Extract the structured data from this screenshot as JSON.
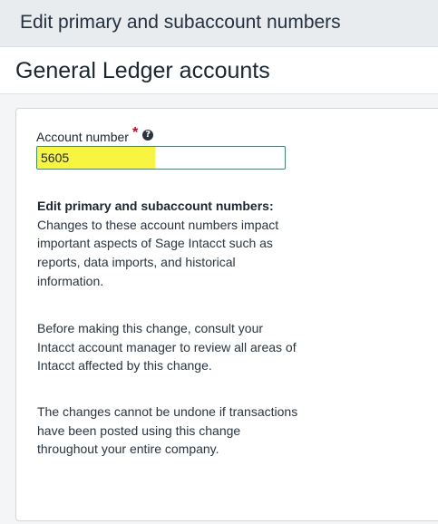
{
  "window": {
    "title": "Edit primary and subaccount numbers"
  },
  "header": {
    "title": "General Ledger accounts"
  },
  "form": {
    "account_number": {
      "label": "Account number",
      "required_marker": "*",
      "help_icon": "question-circle-icon",
      "value": "5605"
    }
  },
  "info": {
    "heading": "Edit primary and subaccount numbers:",
    "paragraph1": "Changes to these account numbers impact important aspects of Sage Intacct such as reports, data imports, and historical information.",
    "paragraph2": "Before making this change, consult your Intacct account manager to review all areas of Intacct affected by this change.",
    "paragraph3": "The changes cannot be undone if transactions have been posted using this change throughout your entire company."
  },
  "colors": {
    "highlight": "#f8f540",
    "input_border": "#3d8a6e",
    "required": "#d0021b"
  }
}
